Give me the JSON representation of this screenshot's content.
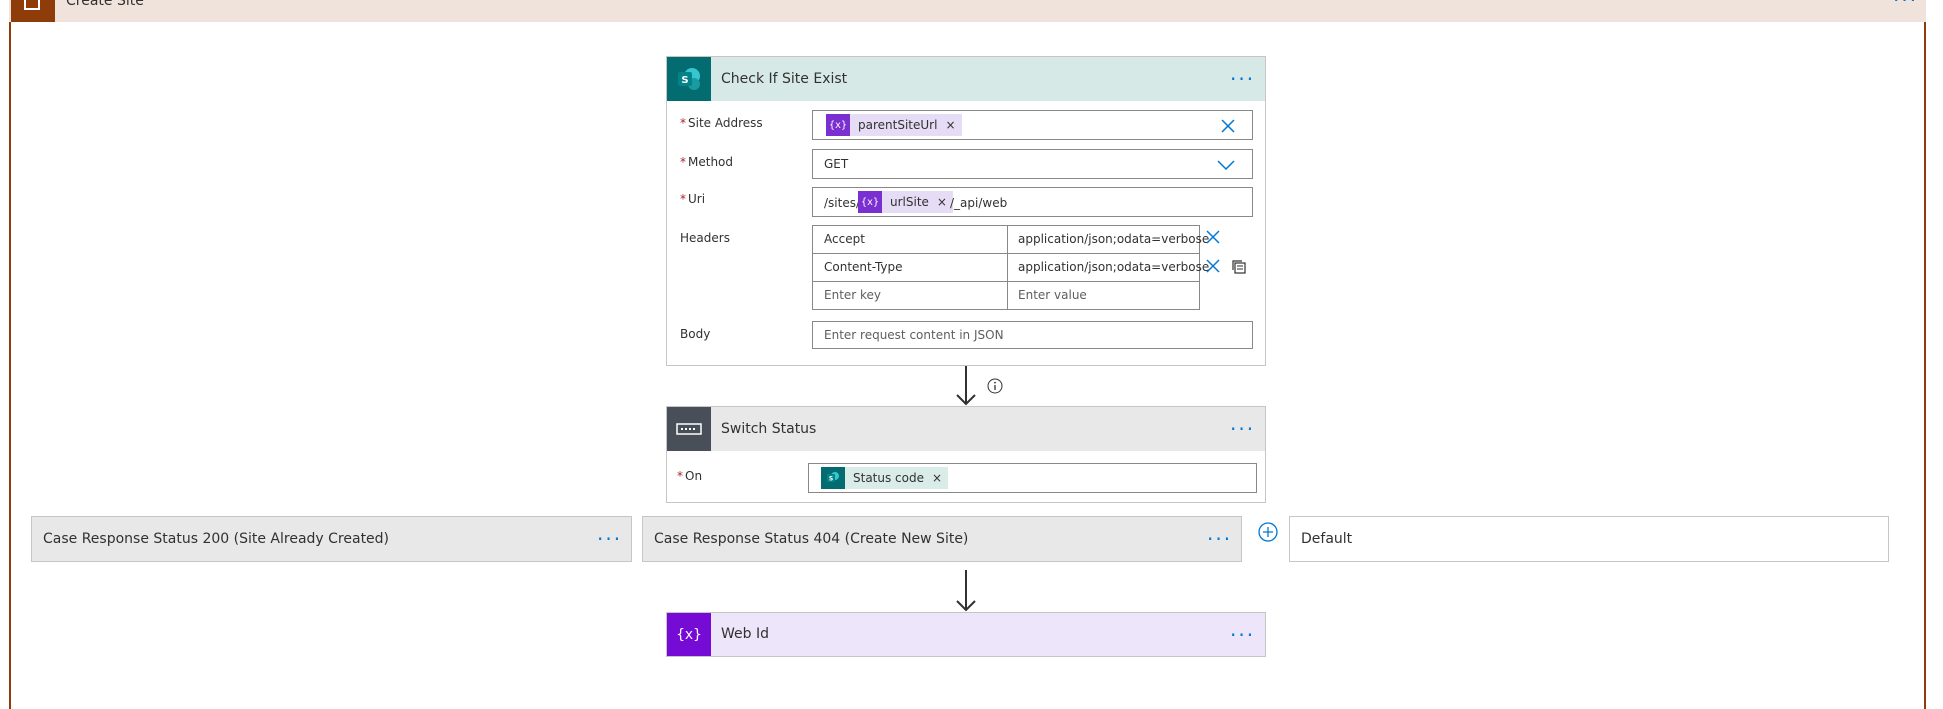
{
  "scope": {
    "title": "Create Site"
  },
  "check_site": {
    "title": "Check If Site Exist",
    "fields": {
      "site_address": {
        "label": "Site Address",
        "token": "parentSiteUrl"
      },
      "method": {
        "label": "Method",
        "value": "GET"
      },
      "uri": {
        "label": "Uri",
        "prefix": "/sites/",
        "token": "urlSite",
        "suffix": "/_api/web"
      },
      "headers": {
        "label": "Headers",
        "rows": [
          {
            "key": "Accept",
            "value": "application/json;odata=verbose"
          },
          {
            "key": "Content-Type",
            "value": "application/json;odata=verbose"
          }
        ],
        "key_placeholder": "Enter key",
        "value_placeholder": "Enter value"
      },
      "body": {
        "label": "Body",
        "placeholder": "Enter request content in JSON"
      }
    }
  },
  "switch_status": {
    "title": "Switch Status",
    "on": {
      "label": "On",
      "token": "Status code"
    }
  },
  "cases": [
    {
      "label": "Case Response Status 200 (Site Already Created)"
    },
    {
      "label": "Case Response Status 404 (Create New Site)"
    }
  ],
  "default_branch": {
    "label": "Default"
  },
  "web_id": {
    "title": "Web Id"
  },
  "symbols": {
    "required": "*",
    "remove": "×",
    "variable_icon": "{x}"
  },
  "colors": {
    "scope_header": "#efe3db",
    "scope_accent": "#8d3c0a",
    "sharepoint_teal": "#036c70",
    "sharepoint_header": "#d6e9e7",
    "control_dark": "#484f58",
    "control_header": "#e8e8e8",
    "variable_purple": "#770bd6",
    "variable_header": "#ede5fa",
    "link_blue": "#0078d4"
  }
}
